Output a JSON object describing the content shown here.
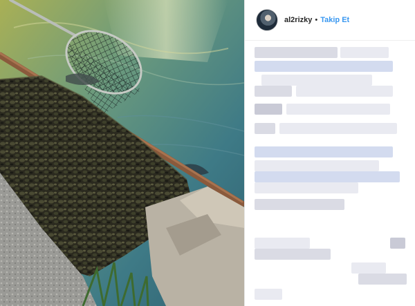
{
  "post": {
    "username": "al2rizky",
    "separator": "•",
    "follow_label": "Takip Et"
  },
  "icons": {
    "avatar": "profile-avatar",
    "photo": "photo-fishing-net-over-water"
  },
  "colors": {
    "follow": "#3897f0",
    "username": "#262626",
    "border": "#e6e6e6"
  }
}
